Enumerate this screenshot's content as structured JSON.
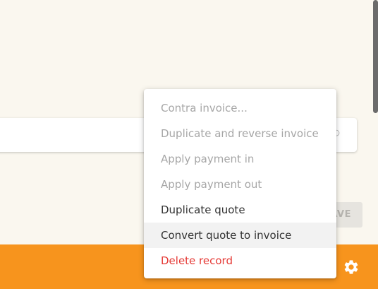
{
  "background_card": {
    "icon": "chevron-icon"
  },
  "save_button": {
    "label": "SAVE"
  },
  "footer": {
    "color": "#f7941d",
    "settings_icon": "gear-icon"
  },
  "context_menu": {
    "items": [
      {
        "label": "Contra invoice...",
        "state": "disabled"
      },
      {
        "label": "Duplicate and reverse invoice",
        "state": "disabled"
      },
      {
        "label": "Apply payment in",
        "state": "disabled"
      },
      {
        "label": "Apply payment out",
        "state": "disabled"
      },
      {
        "label": "Duplicate quote",
        "state": "enabled"
      },
      {
        "label": "Convert quote to invoice",
        "state": "hovered"
      },
      {
        "label": "Delete record",
        "state": "danger"
      }
    ],
    "danger_color": "#e53935"
  }
}
